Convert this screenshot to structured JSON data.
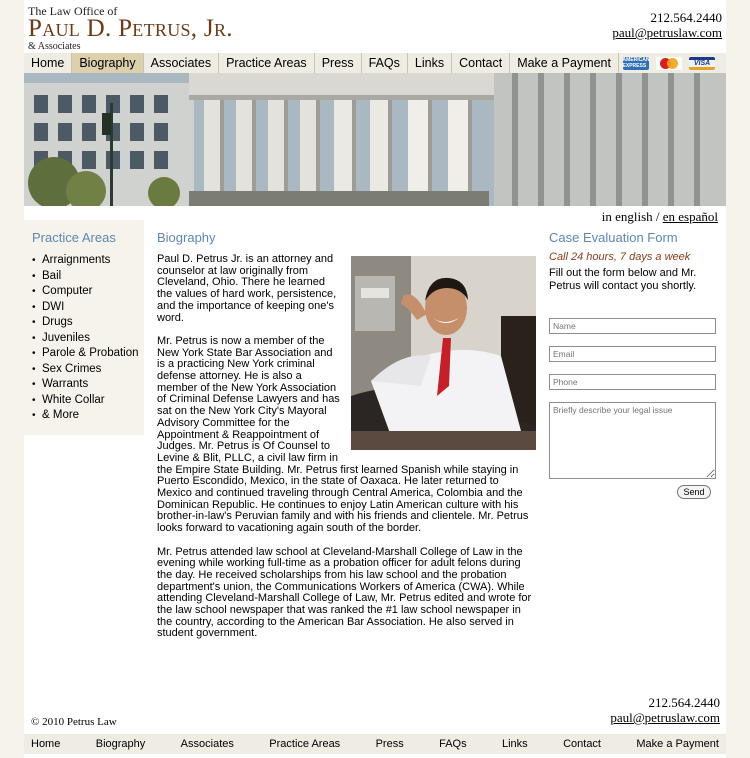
{
  "header": {
    "logo_pre": "The Law Office of",
    "logo_name": "Paul D. Petrus, Jr.",
    "logo_post": "& Associates",
    "phone": "212.564.2440",
    "email": "paul@petruslaw.com"
  },
  "nav": {
    "items": [
      "Home",
      "Biography",
      "Associates",
      "Practice Areas",
      "Press",
      "FAQs",
      "Links",
      "Contact",
      "Make a Payment"
    ],
    "active": "Biography",
    "cards": [
      "AMERICAN EXPRESS",
      "MasterCard",
      "VISA"
    ]
  },
  "language": {
    "english": "in english",
    "separator": "/",
    "spanish": "en español"
  },
  "sidebar": {
    "heading": "Practice Areas",
    "items": [
      "Arraignments",
      "Bail",
      "Computer",
      "DWI",
      "Drugs",
      "Juveniles",
      "Parole & Probation",
      "Sex Crimes",
      "Warrants",
      "White Collar",
      "& More"
    ]
  },
  "main": {
    "heading": "Biography",
    "paragraphs": [
      "Paul D. Petrus Jr. is an attorney and counselor at law originally from Cleveland, Ohio. There he learned the values of hard work, persistence, and the importance of keeping one's word.",
      "Mr. Petrus is now a member of the New York State Bar Association and is a practicing New York criminal defense attorney. He is also a member of the New York Association of Criminal Defense Lawyers and has sat on the New York City's Mayoral Advisory Committee for the Appointment & Reappointment of Judges. Mr. Petrus is Of Counsel to Levine & Blit, PLLC, a civil law firm in the Empire State Building. Mr. Petrus first learned Spanish while staying in Puerto Escondido, Mexico, in the state of Oaxaca. He later returned to Mexico and continued traveling through Central America, Colombia and the Dominican Republic. He continues to enjoy Latin American culture with his brother-in-law's Peruvian family and with his friends and clientele. Mr. Petrus looks forward to vacationing again south of the border.",
      "Mr. Petrus attended law school at Cleveland-Marshall College of Law in the evening while working full-time as a probation officer for adult felons during the day. He received scholarships from his law school and the probation department's union, the Communications Workers of America (CWA). While attending Cleveland-Marshall College of Law, Mr. Petrus edited and wrote for the law school newspaper that was ranked the #1 law school newspaper in the country, according to the American Bar Association. He also served in student government."
    ]
  },
  "form": {
    "heading": "Case Evaluation Form",
    "callout": "Call 24 hours, 7 days a week",
    "intro": "Fill out the form below and Mr. Petrus will contact you shortly.",
    "name_placeholder": "Name",
    "email_placeholder": "Email",
    "phone_placeholder": "Phone",
    "message_placeholder": "Briefly describe your legal issue",
    "send_label": "Send"
  },
  "footer": {
    "copyright": "© 2010 Petrus Law",
    "phone": "212.564.2440",
    "email": "paul@petruslaw.com",
    "nav": [
      "Home",
      "Biography",
      "Associates",
      "Practice Areas",
      "Press",
      "FAQs",
      "Links",
      "Contact",
      "Make a Payment"
    ]
  },
  "colors": {
    "accent_blue": "#5f86b1",
    "brand_brown": "#6b3a16",
    "callout_red": "#8a3b1b",
    "nav_bg": "#efece3",
    "nav_active": "#ddd0ad"
  }
}
